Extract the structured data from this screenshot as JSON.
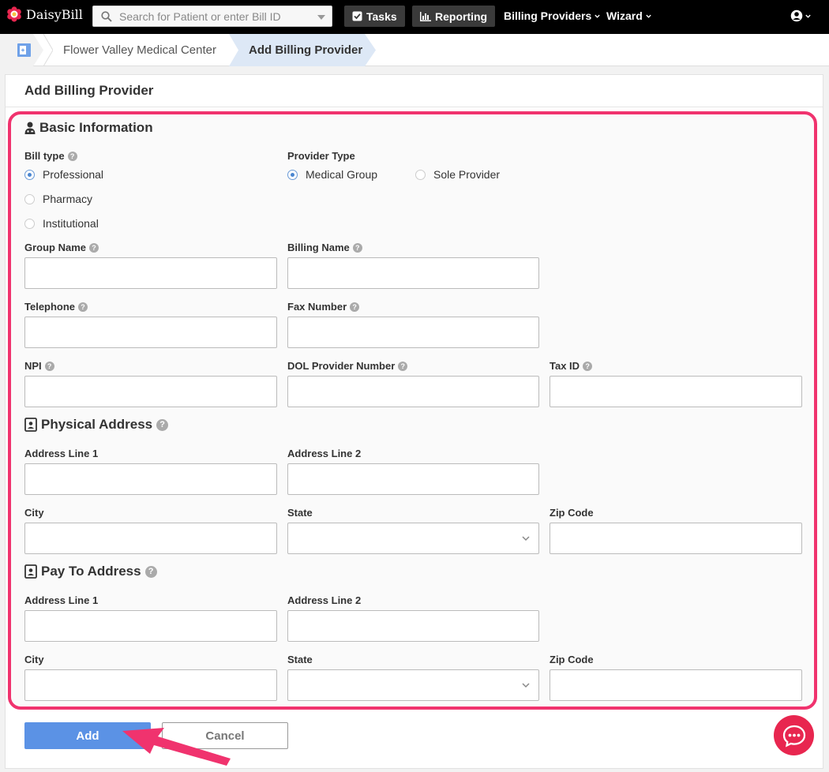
{
  "app": {
    "brand": "DaisyBill",
    "accent_color": "#f0336e",
    "primary_color": "#5b92e5"
  },
  "topnav": {
    "search_placeholder": "Search for Patient or enter Bill ID",
    "tasks_label": "Tasks",
    "reporting_label": "Reporting",
    "billing_providers_label": "Billing Providers",
    "wizard_label": "Wizard",
    "icons": {
      "search": "search-icon",
      "tasks": "check-square-icon",
      "reporting": "bar-chart-icon",
      "user": "user-circle-icon"
    }
  },
  "breadcrumb": {
    "parent": "Flower Valley Medical Center",
    "current": "Add Billing Provider"
  },
  "page": {
    "title": "Add Billing Provider"
  },
  "basic": {
    "title": "Basic Information",
    "bill_type_label": "Bill type",
    "bill_type_options": [
      "Professional",
      "Pharmacy",
      "Institutional"
    ],
    "bill_type_selected": "Professional",
    "provider_type_label": "Provider Type",
    "provider_type_options": [
      "Medical Group",
      "Sole Provider"
    ],
    "provider_type_selected": "Medical Group",
    "group_name_label": "Group Name",
    "billing_name_label": "Billing Name",
    "telephone_label": "Telephone",
    "fax_label": "Fax Number",
    "npi_label": "NPI",
    "dol_label": "DOL Provider Number",
    "tax_id_label": "Tax ID"
  },
  "physical": {
    "title": "Physical Address",
    "address1_label": "Address Line 1",
    "address2_label": "Address Line 2",
    "city_label": "City",
    "state_label": "State",
    "zip_label": "Zip Code"
  },
  "payto": {
    "title": "Pay To Address",
    "address1_label": "Address Line 1",
    "address2_label": "Address Line 2",
    "city_label": "City",
    "state_label": "State",
    "zip_label": "Zip Code"
  },
  "actions": {
    "add_label": "Add",
    "cancel_label": "Cancel"
  }
}
